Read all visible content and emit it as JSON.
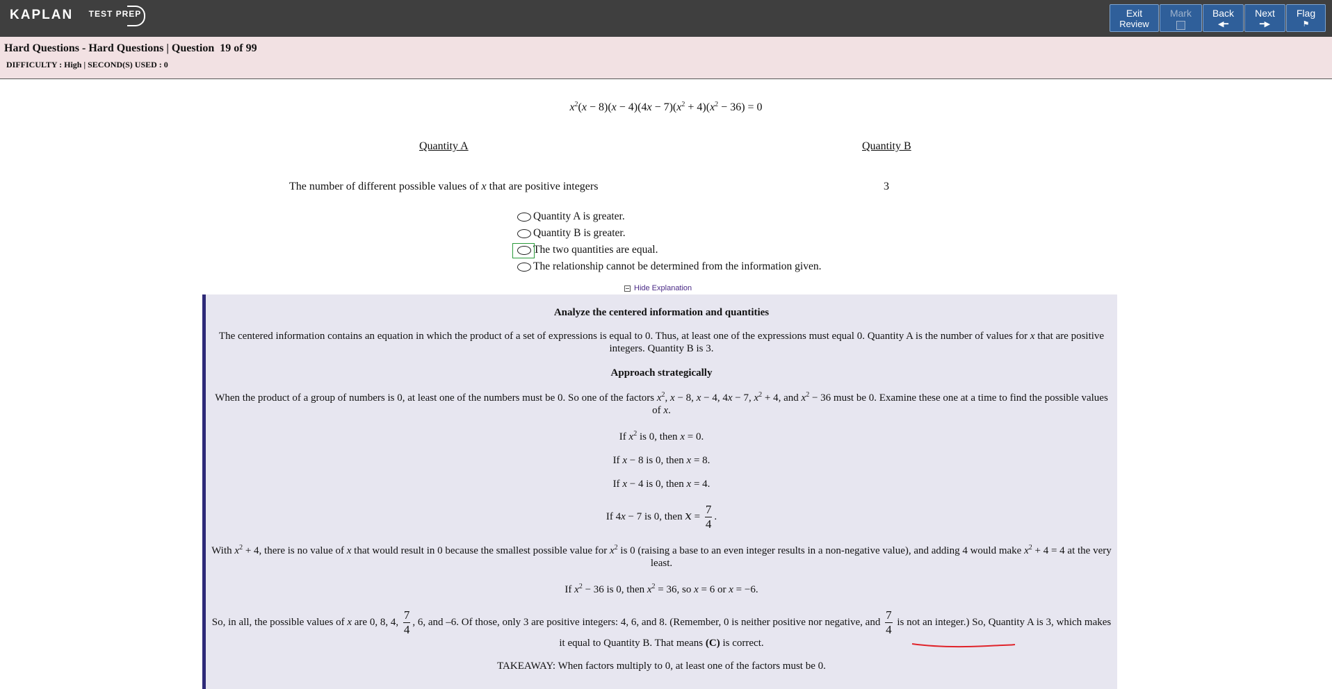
{
  "brand": {
    "main": "KAPLAN",
    "sub": "TEST PREP"
  },
  "nav": {
    "exit": {
      "line1": "Exit",
      "line2": "Review"
    },
    "mark": "Mark",
    "back": "Back",
    "next": "Next",
    "flag": "Flag"
  },
  "header": {
    "title": "Hard Questions - Hard Questions | Question",
    "number": "19 of 99",
    "meta": "DIFFICULTY : High | SECOND(S) USED : 0"
  },
  "question": {
    "equation_html": "<i>x</i><sup>2</sup>(<i>x</i> − 8)(<i>x</i> − 4)(4<i>x</i> − 7)(<i>x</i><sup>2</sup> + 4)(<i>x</i><sup>2</sup> − 36) = 0",
    "quantity_a_label": "Quantity A",
    "quantity_b_label": "Quantity B",
    "quantity_a_html": "The number of different possible values of <i>x</i> that are positive integers",
    "quantity_b": "3",
    "choices": [
      "Quantity A is greater.",
      "Quantity B is greater.",
      "The two quantities are equal.",
      "The relationship cannot be determined from the information given."
    ],
    "hide_explanation": "Hide Explanation"
  },
  "explanation": {
    "heading1": "Analyze the centered information and quantities",
    "para1_html": "The centered information contains an equation in which the product of a set of expressions is equal to 0. Thus, at least one of the expressions must equal 0. Quantity A is the number of values for <i>x</i> that are positive integers. Quantity B is 3.",
    "heading2": "Approach strategically",
    "para2_html": "When the product of a group of numbers is 0, at least one of the numbers must be 0. So one of the factors <i>x</i><sup>2</sup>, <i>x</i> − 8, <i>x</i> − 4, 4<i>x</i> − 7, <i>x</i><sup>2</sup> + 4, and <i>x</i><sup>2</sup> − 36 must be 0. Examine these one at a time to find the possible values of <i>x</i>.",
    "case1_html": "If <i>x</i><sup>2</sup> is 0, then <i>x</i> = 0.",
    "case2_html": "If <i>x</i> − 8 is 0, then <i>x</i> = 8.",
    "case3_html": "If <i>x</i> − 4 is 0, then <i>x</i> = 4.",
    "case4_html": "If 4<i>x</i> − 7 is 0, then <span class=\"math-x\">x</span> = <span class=\"frac\"><span class=\"n\">7</span><span class=\"d\">4</span></span>.",
    "para3_html": "With <i>x</i><sup>2</sup> + 4, there is no value of <i>x</i> that would result in 0 because the smallest possible value for <i>x</i><sup>2</sup> is 0 (raising a base to an even integer results in a non-negative value), and adding 4 would make <i>x</i><sup>2</sup> + 4 = 4 at the very least.",
    "case5_html": "If <i>x</i><sup>2</sup> − 36 is 0, then <i>x</i><sup>2</sup> = 36, so <i>x</i> = 6 or <i>x</i> = −6.",
    "para4_html": "So, in all, the possible values of <i>x</i> are 0, 8, 4, <span class=\"frac\"><span class=\"n\">7</span><span class=\"d\">4</span></span>, 6, and –6. Of those, only 3 are positive integers: 4, 6, and 8. (Remember, 0 is neither positive nor negative, and <span class=\"frac\"><span class=\"n\">7</span><span class=\"d\">4</span></span> is not an integer.) So, Quantity A is 3, which makes it equal to Quantity B. That means <b>(C)</b> is correct.",
    "takeaway": "TAKEAWAY: When factors multiply to 0, at least one of the factors must be 0."
  },
  "colors": {
    "topbar": "#3f3f3f",
    "button": "#2f5f9a",
    "header_bg": "#f2e1e3",
    "explain_bg": "#e7e6f0",
    "explain_border": "#2e2a78",
    "annotation": "#e0232a"
  }
}
